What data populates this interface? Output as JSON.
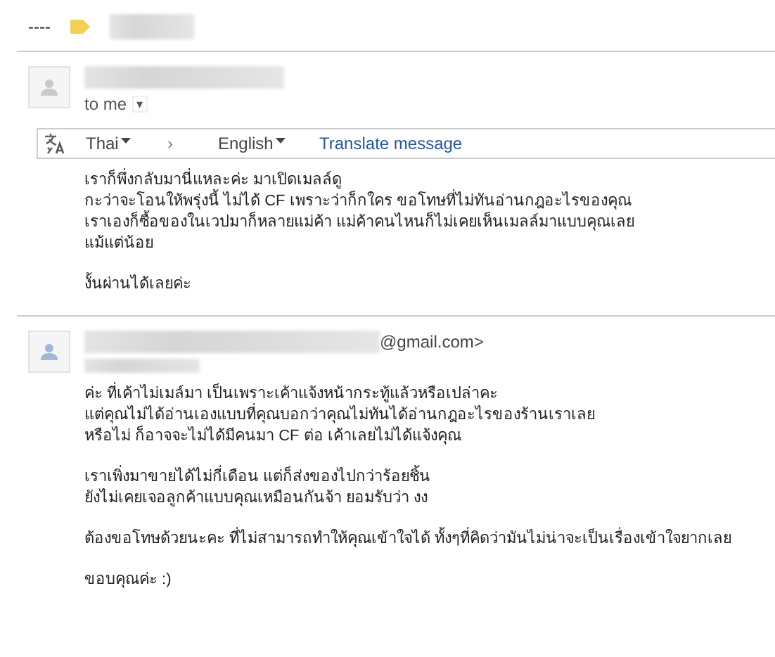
{
  "thread_header": {
    "label": "----"
  },
  "messages": [
    {
      "recipient": "to me",
      "recipient_menu": "▾",
      "translate_bar": {
        "source_language": "Thai",
        "arrow": "›",
        "target_language": "English",
        "action": "Translate message"
      },
      "paragraphs": [
        "เราก็พึ่งกลับมานี่แหละค่ะ มาเปิดเมลล์ดู\nกะว่าจะโอนให้พรุ่งนี้ ไม่ได้ CF เพราะว่าก็กใคร ขอโทษที่ไม่ทันอ่านกฎอะไรของคุณ\nเราเองก็ซื้อของในเวปมาก็หลายแม่ค้า แม่ค้าคนไหนก็ไม่เคยเห็นเมลล์มาแบบคุณเลย\nแม้แต่น้อย",
        "งั้นผ่านได้เลยค่ะ"
      ]
    },
    {
      "email_suffix": "@gmail.com>",
      "paragraphs": [
        "ค่ะ ที่เค้าไม่เมล์มา เป็นเพราะเค้าแจ้งหน้ากระทู้แล้วหรือเปล่าคะ\nแต่คุณไม่ได้อ่านเองแบบที่คุณบอกว่าคุณไม่ทันได้อ่านกฎอะไรของร้านเราเลย\nหรือไม่ ก็อาจจะไม่ได้มีคนมา CF ต่อ เค้าเลยไม่ได้แจ้งคุณ",
        "เราเพิ่งมาขายได้ไม่กี่เดือน แต่ก็ส่งของไปกว่าร้อยชิ้น\nยังไม่เคยเจอลูกค้าแบบคุณเหมือนกันจ้า ยอมรับว่า งง",
        "ต้องขอโทษด้วยนะคะ ที่ไม่สามารถทำให้คุณเข้าใจได้ ทั้งๆที่คิดว่ามันไม่น่าจะเป็นเรื่องเข้าใจยากเลย",
        "ขอบคุณค่ะ :)"
      ]
    }
  ]
}
